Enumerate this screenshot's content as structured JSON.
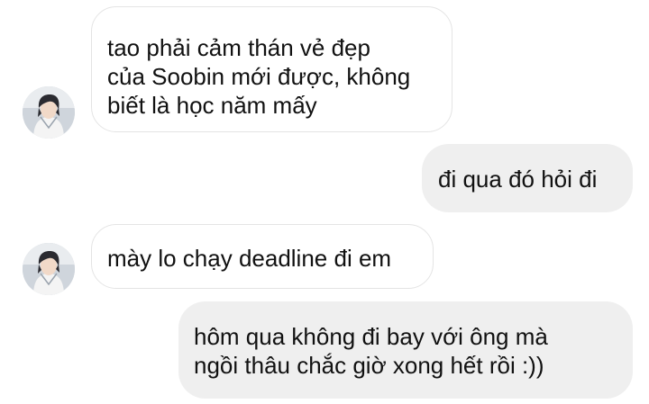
{
  "messages": [
    {
      "id": "m1",
      "direction": "incoming",
      "has_avatar": true,
      "text": "tao phải cảm thán vẻ đẹp\ncủa Soobin mới được, không\nbiết là học năm mấy"
    },
    {
      "id": "m2",
      "direction": "outgoing",
      "has_avatar": false,
      "text": "đi qua đó hỏi đi"
    },
    {
      "id": "m3",
      "direction": "incoming",
      "has_avatar": true,
      "text": "mày lo chạy deadline đi em"
    },
    {
      "id": "m4",
      "direction": "outgoing",
      "has_avatar": false,
      "text": "hôm qua không đi bay với ông mà\nngồi thâu chắc giờ xong hết rồi :))"
    }
  ],
  "colors": {
    "incoming_bubble_bg": "#ffffff",
    "incoming_bubble_border": "#e4e4e4",
    "outgoing_bubble_bg": "#efefef",
    "text": "#111111"
  },
  "icons": {
    "avatar": "contact-avatar-photo"
  }
}
